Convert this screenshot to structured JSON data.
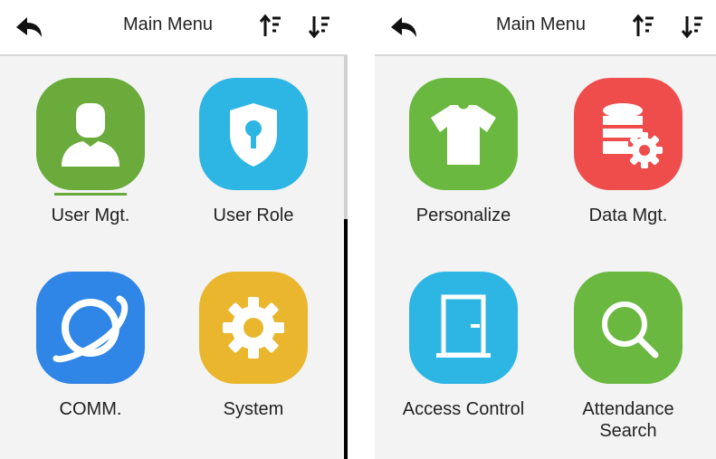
{
  "screens": [
    {
      "title": "Main Menu",
      "items": [
        {
          "label": "User Mgt.",
          "icon": "user-icon",
          "color": "#6aab3c",
          "selected": true
        },
        {
          "label": "User Role",
          "icon": "shield-keyhole-icon",
          "color": "#2db5e3"
        },
        {
          "label": "COMM.",
          "icon": "planet-icon",
          "color": "#2f86e6"
        },
        {
          "label": "System",
          "icon": "gear-icon",
          "color": "#e9b62e"
        }
      ]
    },
    {
      "title": "Main Menu",
      "items": [
        {
          "label": "Personalize",
          "icon": "t-shirt-icon",
          "color": "#6ab83f"
        },
        {
          "label": "Data Mgt.",
          "icon": "database-gear-icon",
          "color": "#ef4c4c"
        },
        {
          "label": "Access Control",
          "icon": "door-icon",
          "color": "#2db5e3"
        },
        {
          "label": "Attendance\nSearch",
          "icon": "search-icon",
          "color": "#6ab83f"
        }
      ]
    }
  ]
}
